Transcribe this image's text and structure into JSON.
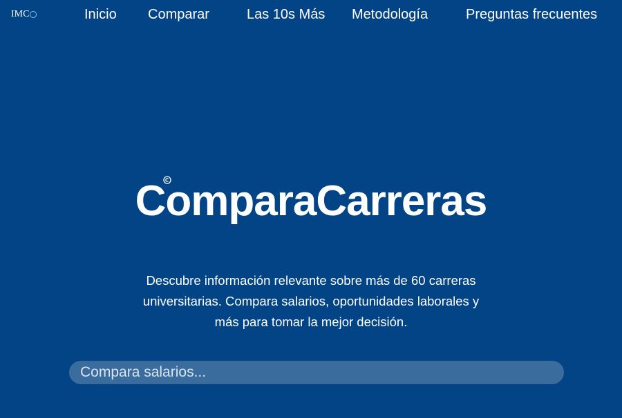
{
  "colors": {
    "background": "#024485",
    "text": "#ffffff",
    "search_background": "#3a6d9e",
    "logo_accent": "#7fc6ee"
  },
  "header": {
    "logo": {
      "text": "IMC",
      "icon": "circle-logo-icon"
    },
    "nav": [
      {
        "label": "Inicio"
      },
      {
        "label": "Comparar"
      },
      {
        "label": "Las 10s Más"
      },
      {
        "label": "Metodología"
      },
      {
        "label": "Preguntas frecuentes"
      }
    ]
  },
  "hero": {
    "brand": "ComparaCarreras",
    "brand_mark_icon": "copyright-icon",
    "tagline_lines": [
      "Descubre información relevante sobre más de 60 carreras",
      "universitarias. Compara salarios, oportunidades laborales y",
      "más para tomar la mejor decisión."
    ]
  },
  "search": {
    "placeholder": "Compara salarios...",
    "value": ""
  }
}
